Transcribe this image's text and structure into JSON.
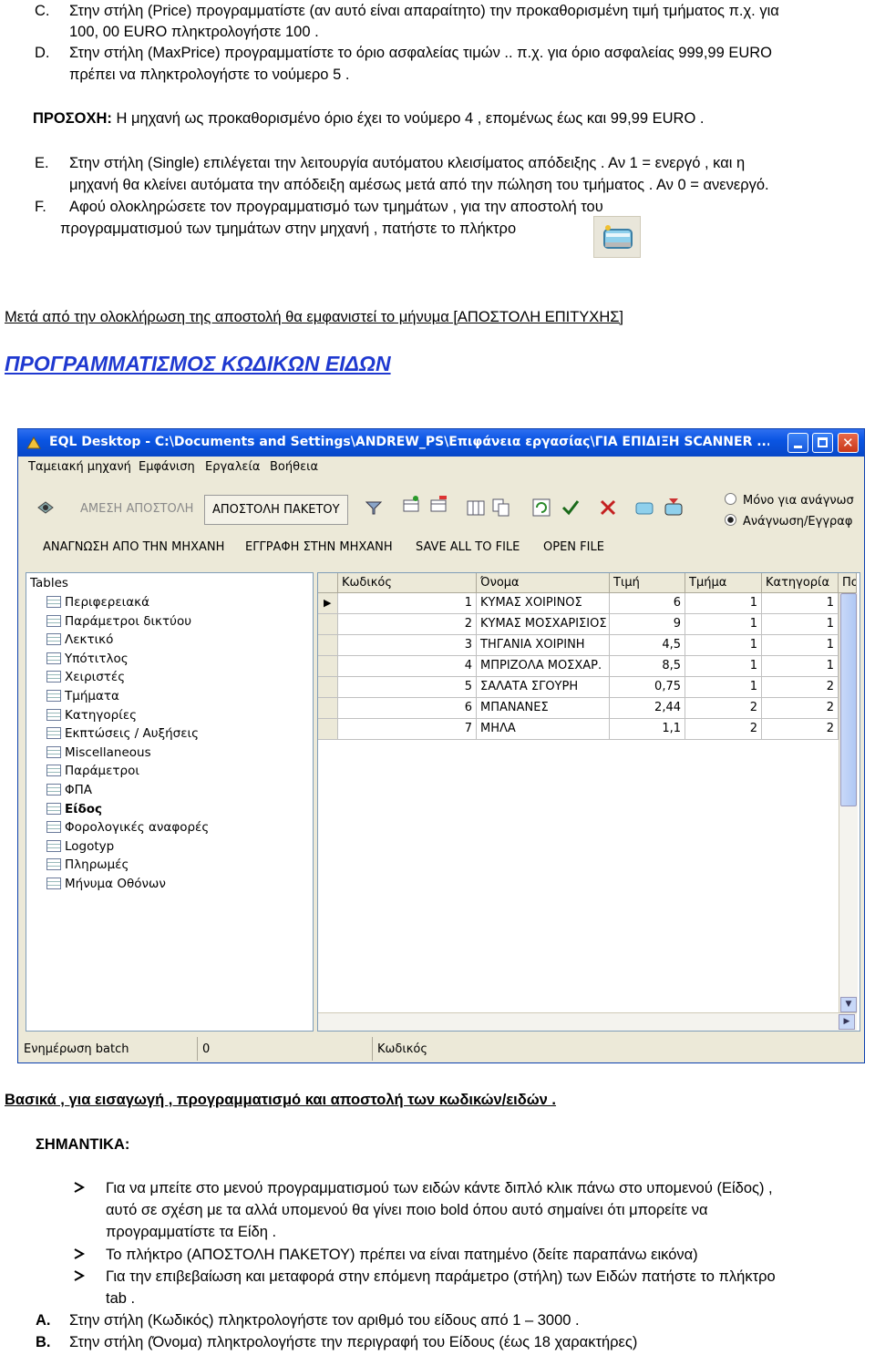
{
  "intro": {
    "c_marker": "C.",
    "c_line1": "Στην στήλη (Price) προγραμματίστε (αν αυτό είναι απαραίτητο) την προκαθορισμένη τιμή τμήματος   π.χ. για",
    "c_line2": "100, 00 EURO πληκτρολογήστε 100 .",
    "d_marker": "D.",
    "d_line1": "Στην στήλη (MaxPrice) προγραμματίστε το όριο ασφαλείας τιμών .. π.χ. για όριο ασφαλείας 999,99 EURO",
    "d_line2": "πρέπει να πληκτρολογήστε το νούμερο 5 .",
    "attention_label": "ΠΡΟΣΟΧΗ:",
    "attention_text": " Η μηχανή ως προκαθορισμένο όριο έχει  το νούμερο 4 , επομένως έως και 99,99  EURO .",
    "e_marker": "E.",
    "e_line1": "Στην στήλη (Single) επιλέγεται την λειτουργία αυτόματου κλεισίματος  απόδειξης . Αν  1 = ενεργό , και η",
    "e_line2": "μηχανή θα κλείνει αυτόματα την απόδειξη αμέσως μετά από την πώληση του τμήματος . Αν 0 = ανενεργό.",
    "f_marker": "F.",
    "f_line1": "Αφού ολοκληρώσετε τον προγραμματισμό των τμημάτων ,  για την  αποστολή του",
    "f_line2": "προγραμματισμού των τμημάτων στην μηχανή   , πατήστε το πλήκτρο",
    "after_send": "Μετά από την ολοκλήρωση της αποστολή θα εμφανιστεί το μήνυμα [ΑΠΟΣΤΟΛΗ ΕΠΙΤΥΧΗΣ]",
    "heading": "ΠΡΟΓΡΑΜΜΑΤΙΣΜΟΣ ΚΩΔΙΚΩΝ ΕΙΔΩΝ"
  },
  "window": {
    "title": "EQL Desktop - C:\\Documents and Settings\\ANDREW_PS\\Επιφάνεια εργασίας\\ΓΙΑ ΕΠΙΔΙΞΗ SCANNER ...",
    "menu": [
      "Ταμειακή μηχανή",
      "Εμφάνιση",
      "Εργαλεία",
      "Βοήθεια"
    ],
    "send_direct": "ΑΜΕΣΗ ΑΠΟΣΤΟΛΗ",
    "send_packet": "ΑΠΟΣΤΟΛΗ ΠΑΚΕΤΟΥ",
    "radio_read_only": "Μόνο για ανάγνωσ",
    "radio_read_write": "Ανάγνωση/Εγγραφ",
    "read_from_machine": "ΑΝΑΓΝΩΣΗ ΑΠΟ ΤΗΝ ΜΗΧΑΝΗ",
    "write_to_machine": "ΕΓΓΡΑΦΗ ΣΤΗΝ ΜΗΧΑΝΗ",
    "save_all": "SAVE ALL TO FILE",
    "open_file": "OPEN FILE",
    "tables_label": "Tables",
    "tables": [
      "Περιφερειακά",
      "Παράμετροι δικτύου",
      "Λεκτικό",
      "Υπότιτλος",
      "Χειριστές",
      "Τμήματα",
      "Κατηγορίες",
      "Εκπτώσεις / Αυξήσεις",
      "Miscellaneous",
      "Παράμετροι",
      "ΦΠΑ",
      "Είδος",
      "Φορολογικές αναφορές",
      "Logotyp",
      "Πληρωμές",
      "Μήνυμα Οθόνων"
    ],
    "columns": [
      "Κωδικός",
      "Όνομα",
      "Τιμή",
      "Τμήμα",
      "Κατηγορία",
      "Πο"
    ],
    "rows": [
      [
        "1",
        "ΚΥΜΑΣ ΧΟΙΡΙΝΟΣ",
        "6",
        "1",
        "1"
      ],
      [
        "2",
        "ΚΥΜΑΣ ΜΟΣΧΑΡΙΣΙΟΣ",
        "9",
        "1",
        "1"
      ],
      [
        "3",
        "ΤΗΓΑΝΙΑ ΧΟΙΡΙΝΗ",
        "4,5",
        "1",
        "1"
      ],
      [
        "4",
        "ΜΠΡΙΖΟΛΑ ΜΟΣΧΑΡ.",
        "8,5",
        "1",
        "1"
      ],
      [
        "5",
        "ΣΑΛΑΤΑ ΣΓΟΥΡΗ",
        "0,75",
        "1",
        "2"
      ],
      [
        "6",
        "ΜΠΑΝΑΝΕΣ",
        "2,44",
        "2",
        "2"
      ],
      [
        "7",
        "ΜΗΛΑ",
        "1,1",
        "2",
        "2"
      ]
    ],
    "status_batch_label": "Ενημέρωση batch",
    "status_batch_value": "0",
    "status_code_label": "Κωδικός"
  },
  "outro": {
    "basics": "Βασικά , για εισαγωγή , προγραμματισμό και αποστολή των κωδικών/ειδών .",
    "important": "ΣΗΜΑΝΤΙΚΑ:",
    "bullet1_l1": "Για να μπείτε στο μενού προγραμματισμού των ειδών  κάντε διπλό κλικ πάνω στο υπομενού (Είδος) ,",
    "bullet1_l2": "αυτό σε σχέση με τα αλλά υπομενού  θα γίνει ποιο bold  όπου αυτό σημαίνει ότι μπορείτε να",
    "bullet1_l3": "προγραμματίστε τα Είδη .",
    "bullet2": "Το πλήκτρο (ΑΠΟΣΤΟΛΗ ΠΑΚΕΤΟΥ) πρέπει να είναι πατημένο (δείτε παραπάνω εικόνα)",
    "bullet3_l1": "Για την επιβεβαίωση και μεταφορά στην  επόμενη παράμετρο  (στήλη) των Ειδών  πατήστε το πλήκτρο",
    "bullet3_l2": "tab .",
    "a_marker": "A.",
    "a_text": "Στην στήλη (Κωδικός) πληκτρολογήστε τον αριθμό του είδους  από 1 – 3000 .",
    "b_marker": "B.",
    "b_text": "Στην στήλη (Όνομα)  πληκτρολογήστε την περιγραφή του Είδους (έως 18 χαρακτήρες)"
  }
}
